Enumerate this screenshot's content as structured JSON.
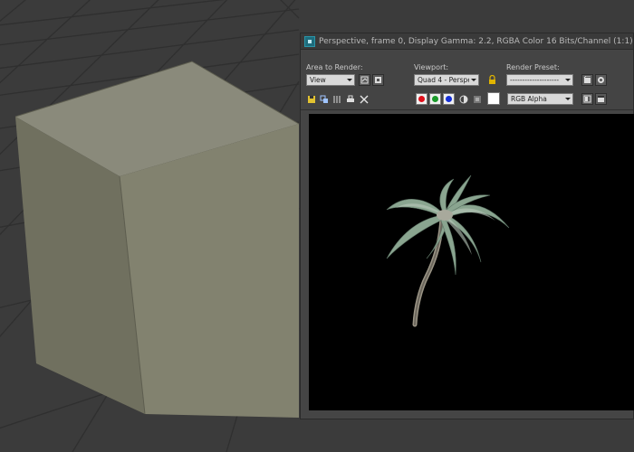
{
  "window": {
    "title": "Perspective, frame 0, Display Gamma: 2.2, RGBA Color 16 Bits/Channel (1:1)"
  },
  "controls": {
    "area_to_render": {
      "label": "Area to Render:",
      "value": "View"
    },
    "viewport": {
      "label": "Viewport:",
      "value": "Quad 4 - Perspec"
    },
    "render_preset": {
      "label": "Render Preset:",
      "value": "--------------------"
    }
  },
  "toolbar": {
    "channel_display": "RGB Alpha",
    "channel_colors": {
      "red": "#e0101b",
      "green": "#1a9a2a",
      "blue": "#1630d8"
    },
    "swatch_color": "#ffffff"
  },
  "scene": {
    "viewport_background": "#3b3b3b",
    "grid_color": "#2e2e2e",
    "box_color": "#77776a",
    "render_background": "#000000"
  }
}
